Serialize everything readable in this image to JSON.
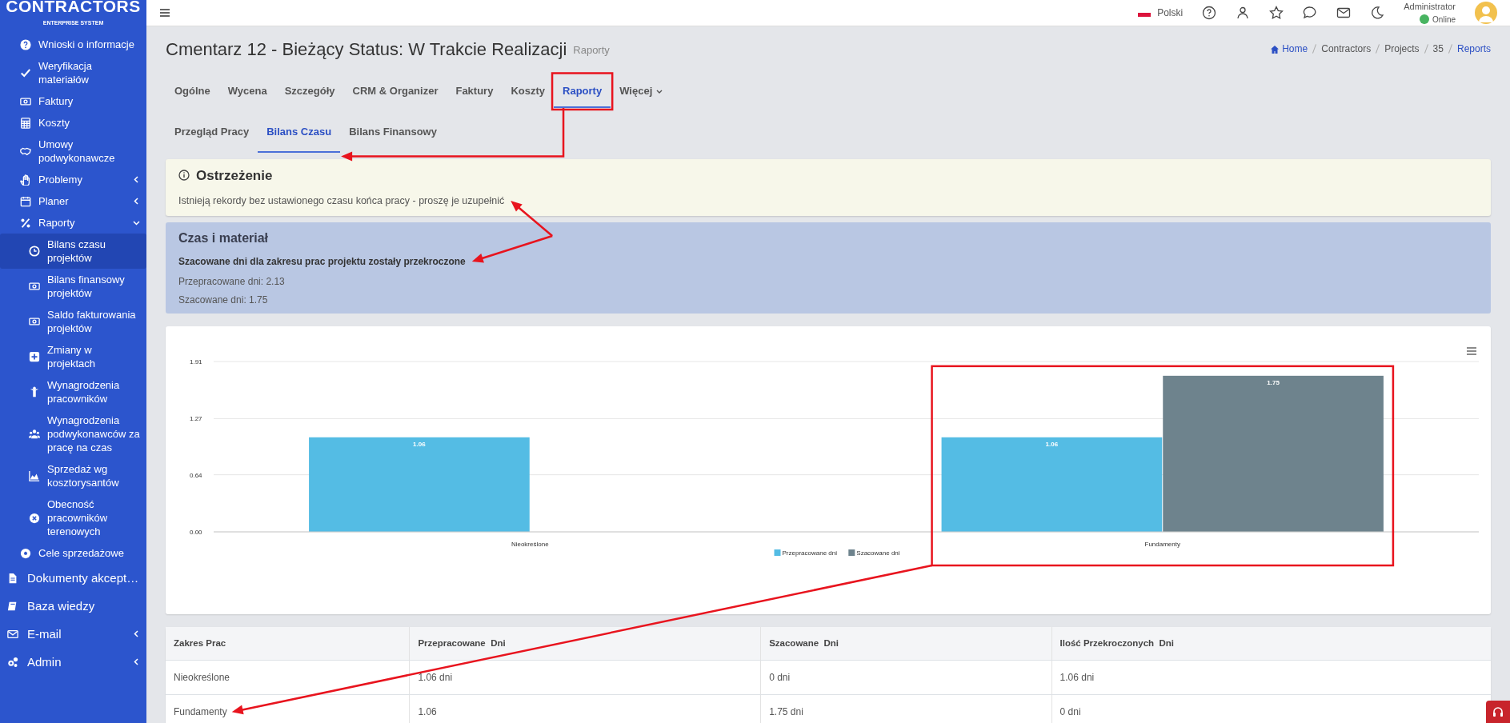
{
  "sidebar": {
    "logo": {
      "title": "CONTRACTORS",
      "subtitle": "ENTERPRISE SYSTEM"
    },
    "items": [
      {
        "kind": "sub",
        "label": "Wnioski o informacje",
        "selected": false
      },
      {
        "kind": "sub",
        "label": "Weryfikacja materiałów",
        "selected": false
      },
      {
        "kind": "sub",
        "label": "Faktury",
        "selected": false
      },
      {
        "kind": "sub",
        "label": "Koszty",
        "selected": false
      },
      {
        "kind": "sub",
        "label": "Umowy podwykonawcze",
        "selected": false
      },
      {
        "kind": "sub",
        "label": "Problemy",
        "selected": false,
        "expanded": false
      },
      {
        "kind": "sub",
        "label": "Planer",
        "selected": false,
        "expanded": false
      },
      {
        "kind": "sub",
        "label": "Raporty",
        "selected": false,
        "expanded": true,
        "children": [
          {
            "label": "Bilans czasu projektów",
            "selected": true
          },
          {
            "label": "Bilans finansowy projektów",
            "selected": false
          },
          {
            "label": "Saldo fakturowania projektów",
            "selected": false
          },
          {
            "label": "Zmiany w projektach",
            "selected": false
          },
          {
            "label": "Wynagrodzenia pracowników",
            "selected": false
          },
          {
            "label": "Wynagrodzenia podwykonawców za pracę na czas",
            "selected": false
          },
          {
            "label": "Sprzedaż wg kosztorysantów",
            "selected": false
          },
          {
            "label": "Obecność pracowników terenowych",
            "selected": false
          }
        ]
      },
      {
        "kind": "sub",
        "label": "Cele sprzedażowe",
        "selected": false
      },
      {
        "kind": "main",
        "label": "Dokumenty akcept…",
        "selected": false
      },
      {
        "kind": "main",
        "label": "Baza wiedzy",
        "selected": false
      },
      {
        "kind": "main",
        "label": "E-mail",
        "selected": false,
        "expanded": false
      },
      {
        "kind": "main",
        "label": "Admin",
        "selected": false,
        "expanded": false
      }
    ]
  },
  "header": {
    "language": "Polski",
    "user": "Administrator",
    "status": "Online"
  },
  "page": {
    "title": "Cmentarz 12 - Bieżący Status: W Trakcie Realizacji",
    "subtitle": "Raporty",
    "breadcrumb": [
      {
        "label": "Home",
        "link": true
      },
      {
        "label": "Contractors",
        "link": false
      },
      {
        "label": "Projects",
        "link": false
      },
      {
        "label": "35",
        "link": false
      },
      {
        "label": "Reports",
        "link": true
      }
    ]
  },
  "main_tabs": [
    {
      "label": "Ogólne",
      "selected": false,
      "has_menu": false,
      "boxed": false
    },
    {
      "label": "Wycena",
      "selected": false,
      "has_menu": false,
      "boxed": false
    },
    {
      "label": "Szczegóły",
      "selected": false,
      "has_menu": false,
      "boxed": false
    },
    {
      "label": "CRM & Organizer",
      "selected": false,
      "has_menu": false,
      "boxed": false
    },
    {
      "label": "Faktury",
      "selected": false,
      "has_menu": false,
      "boxed": false
    },
    {
      "label": "Koszty",
      "selected": false,
      "has_menu": false,
      "boxed": false
    },
    {
      "label": "Raporty",
      "selected": true,
      "has_menu": false,
      "boxed": true
    },
    {
      "label": "Więcej",
      "selected": false,
      "has_menu": true,
      "boxed": false
    }
  ],
  "sub_tabs": [
    {
      "label": "Przegląd Pracy",
      "selected": false,
      "pointed": false
    },
    {
      "label": "Bilans Czasu",
      "selected": true,
      "pointed": true
    },
    {
      "label": "Bilans Finansowy",
      "selected": false,
      "pointed": false
    }
  ],
  "warning": {
    "title": "Ostrzeżenie",
    "message": "Istnieją rekordy bez ustawionego czasu końca pracy - proszę je uzupełnić",
    "pointed": true
  },
  "summary": {
    "title": "Czas i materiał",
    "pointed": true,
    "alert": "Szacowane dni dla zakresu prac projektu zostały przekroczone",
    "lines": [
      "Przepracowane dni: 2.13",
      "Szacowane dni: 1.75"
    ]
  },
  "chart": {
    "boxed_categories": [
      false,
      true
    ],
    "chart_data": {
      "type": "bar",
      "categories": [
        "Nieokreślone",
        "Fundamenty"
      ],
      "series": [
        {
          "name": "Przepracowane dni",
          "color": "#54bce4",
          "values": [
            1.06,
            1.06
          ]
        },
        {
          "name": "Szacowane dni",
          "color": "#6e838d",
          "values": [
            null,
            1.75
          ]
        }
      ],
      "ylim": [
        0,
        1.91
      ],
      "yticks": [
        {
          "value": 0,
          "label": "0.00"
        },
        {
          "value": 0.64,
          "label": "0.64"
        },
        {
          "value": 1.27,
          "label": "1.27"
        },
        {
          "value": 1.91,
          "label": "1.91"
        }
      ],
      "data_labels": true,
      "legend": "bottom"
    }
  },
  "table": {
    "columns": [
      "Zakres Prac",
      "Przepracowane  Dni",
      "Szacowane  Dni",
      "Ilość Przekroczonych  Dni"
    ],
    "rows": [
      {
        "cells": [
          "Nieokreślone",
          "1.06 dni",
          "0 dni",
          "1.06 dni"
        ],
        "pointed": false
      },
      {
        "cells": [
          "Fundamenty",
          "1.06",
          "1.75 dni",
          "0 dni"
        ],
        "pointed": true
      }
    ]
  }
}
